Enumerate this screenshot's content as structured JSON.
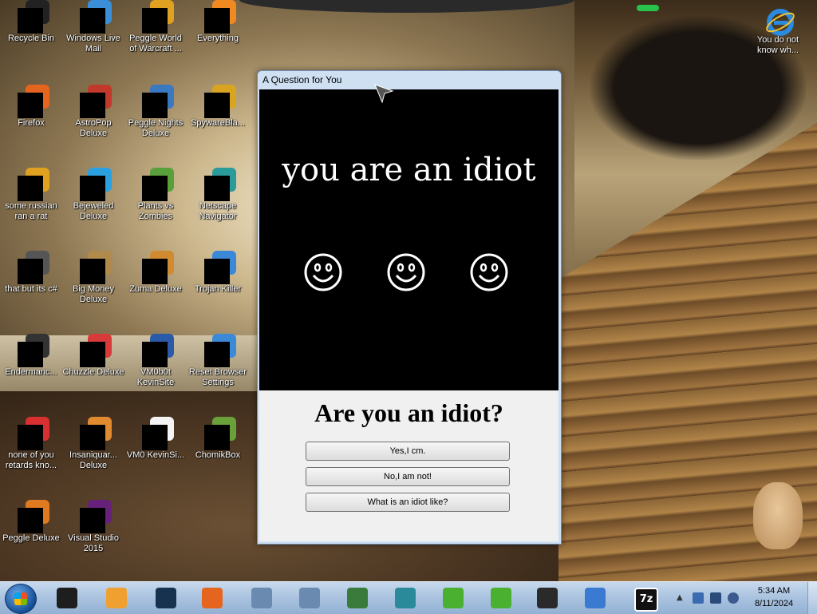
{
  "desktop": {
    "icons": [
      {
        "label": "Recycle Bin",
        "icon": "recycle-bin-icon",
        "color": "#222222"
      },
      {
        "label": "Windows Live Mail",
        "icon": "mail-icon",
        "color": "#3a8fd8"
      },
      {
        "label": "Peggle World of Warcraft ...",
        "icon": "peggle-icon",
        "color": "#e0a020"
      },
      {
        "label": "Everything",
        "icon": "search-icon",
        "color": "#f08a20"
      },
      {
        "label": "Firefox",
        "icon": "firefox-icon",
        "color": "#e5651f"
      },
      {
        "label": "AstroPop Deluxe",
        "icon": "astropop-icon",
        "color": "#c0392b"
      },
      {
        "label": "Peggle Nights Deluxe",
        "icon": "peggle-icon",
        "color": "#3a78c0"
      },
      {
        "label": "SpywareBla...",
        "icon": "shield-icon",
        "color": "#d9a520"
      },
      {
        "label": "some russian ran a rat",
        "icon": "exe-icon",
        "color": "#e0a020"
      },
      {
        "label": "Bejeweled Deluxe",
        "icon": "gem-icon",
        "color": "#2aa0e0"
      },
      {
        "label": "Plants vs Zombies",
        "icon": "plant-icon",
        "color": "#5aa03a"
      },
      {
        "label": "Netscape Navigator",
        "icon": "netscape-icon",
        "color": "#2a9a9a"
      },
      {
        "label": "that but its c#",
        "icon": "shortcut-icon",
        "color": "#555555"
      },
      {
        "label": "Big Money Deluxe",
        "icon": "money-icon",
        "color": "#b08a4a"
      },
      {
        "label": "Zuma Deluxe",
        "icon": "zuma-icon",
        "color": "#d08a30"
      },
      {
        "label": "Trojan Killer",
        "icon": "shield-icon",
        "color": "#3a88d8"
      },
      {
        "label": "Endermanc...",
        "icon": "terminal-icon",
        "color": "#333333"
      },
      {
        "label": "Chuzzle Deluxe",
        "icon": "chuzzle-icon",
        "color": "#d83a3a"
      },
      {
        "label": "VM0b0t KevinSite",
        "icon": "vm-icon",
        "color": "#2a5aa8"
      },
      {
        "label": "Reset Browser Settings",
        "icon": "globe-icon",
        "color": "#3a8ad8"
      },
      {
        "label": "none of you retards kno...",
        "icon": "opera-icon",
        "color": "#d83030"
      },
      {
        "label": "Insaniquar... Deluxe",
        "icon": "fish-icon",
        "color": "#e08a30"
      },
      {
        "label": "VM0 KevinSi...",
        "icon": "document-icon",
        "color": "#f4f4f4"
      },
      {
        "label": "ChomikBox",
        "icon": "chomikbox-icon",
        "color": "#6aa03a"
      },
      {
        "label": "Peggle Deluxe",
        "icon": "peggle-icon",
        "color": "#e07a20"
      },
      {
        "label": "Visual Studio 2015",
        "icon": "visual-studio-icon",
        "color": "#68217a"
      }
    ],
    "ie_icon": {
      "label": "You do not know wh...",
      "icon": "internet-explorer-icon",
      "color": "#2a8ae0"
    }
  },
  "window": {
    "title": "A Question for You",
    "headline": "you are an idiot",
    "smileys": [
      "☺",
      "☺",
      "☺"
    ],
    "question": "Are you an idiot?",
    "buttons": {
      "yes": "Yes,I cm.",
      "no": "No,I am not!",
      "what": "What is an idiot like?"
    }
  },
  "taskbar": {
    "pinned": [
      {
        "name": "taskbar-app-1",
        "icon": "terminal-icon",
        "color": "#1e1e1e"
      },
      {
        "name": "taskbar-media-player",
        "icon": "media-player-icon",
        "color": "#f0a030"
      },
      {
        "name": "taskbar-app-3",
        "icon": "orb-icon",
        "color": "#16324f"
      },
      {
        "name": "taskbar-firefox",
        "icon": "firefox-icon",
        "color": "#e5651f"
      },
      {
        "name": "taskbar-network-1",
        "icon": "network-icon",
        "color": "#6a8ab0"
      },
      {
        "name": "taskbar-network-2",
        "icon": "network-icon",
        "color": "#6a8ab0"
      },
      {
        "name": "taskbar-users",
        "icon": "users-icon",
        "color": "#3a7a3a"
      },
      {
        "name": "taskbar-netscape",
        "icon": "netscape-icon",
        "color": "#2a8a9a"
      },
      {
        "name": "taskbar-add-1",
        "icon": "plus-icon",
        "color": "#4ab030"
      },
      {
        "name": "taskbar-add-2",
        "icon": "plus-icon",
        "color": "#4ab030"
      },
      {
        "name": "taskbar-monitor",
        "icon": "monitor-icon",
        "color": "#2a2a2a"
      },
      {
        "name": "taskbar-shield",
        "icon": "shield-icon",
        "color": "#3a7ad0"
      },
      {
        "name": "taskbar-7zip",
        "icon": "seven-zip-icon",
        "color": "#111111",
        "text": "7z"
      }
    ],
    "clock": {
      "time": "5:34 AM",
      "date": "8/11/2024"
    }
  }
}
